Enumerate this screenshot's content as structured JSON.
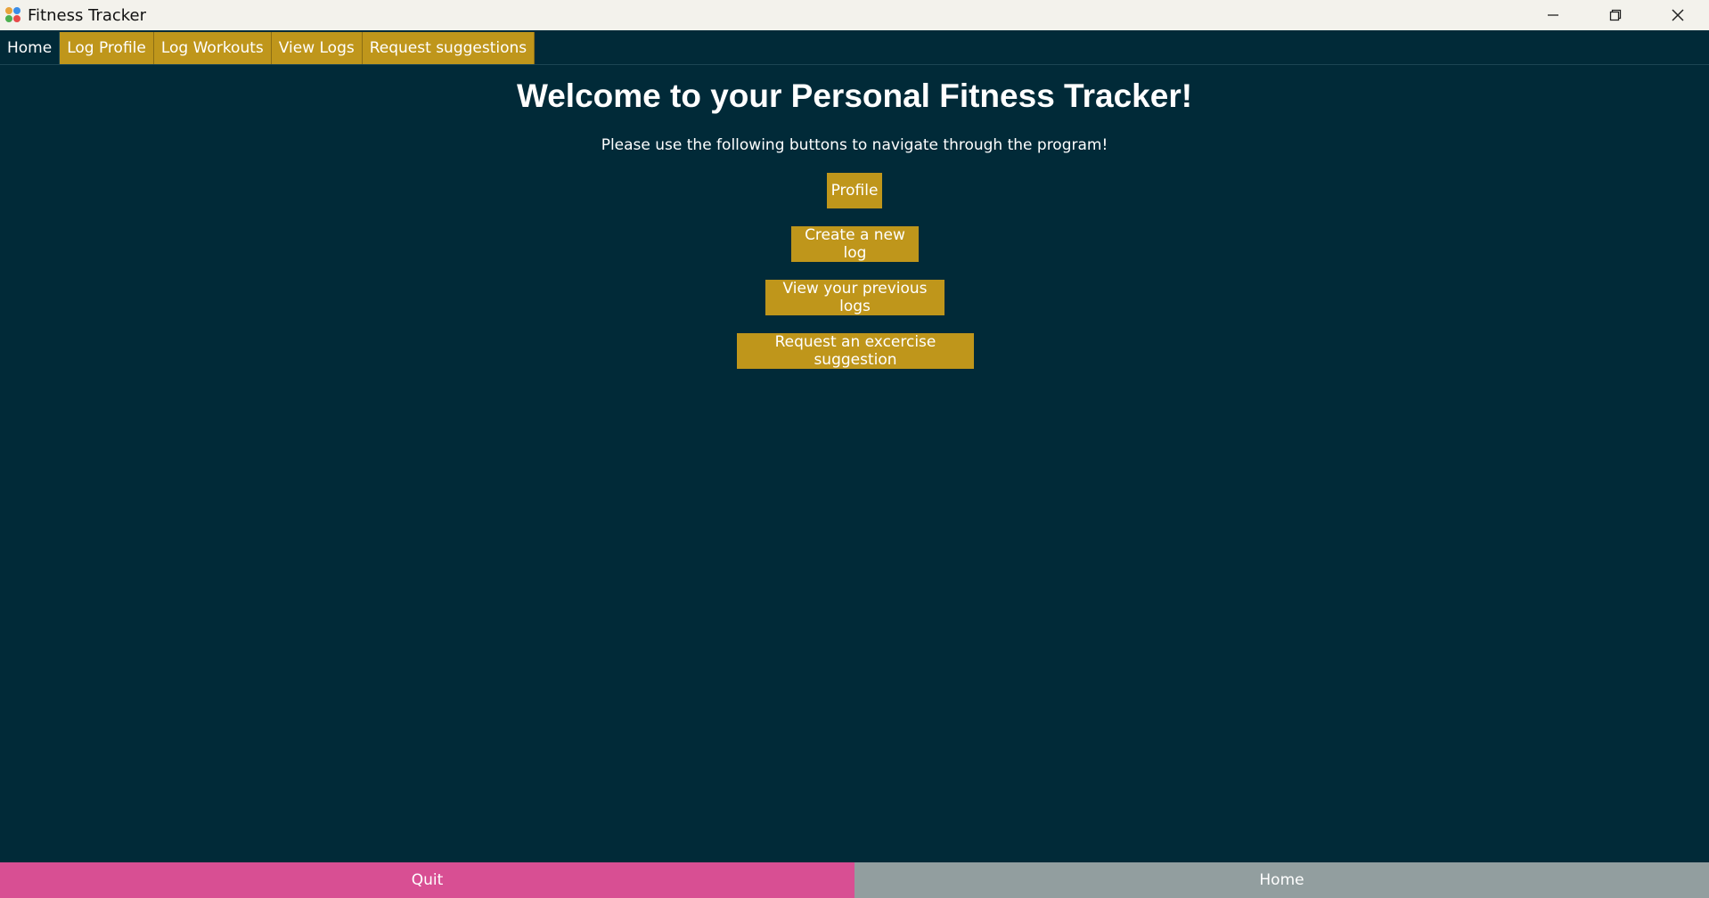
{
  "window": {
    "title": "Fitness Tracker",
    "icon": "app-dots-icon",
    "controls": [
      "minimize-icon",
      "restore-icon",
      "close-icon"
    ]
  },
  "tabs": [
    {
      "label": "Home",
      "active": true
    },
    {
      "label": "Log Profile",
      "active": false
    },
    {
      "label": "Log Workouts",
      "active": false
    },
    {
      "label": "View Logs",
      "active": false
    },
    {
      "label": "Request suggestions",
      "active": false
    }
  ],
  "main": {
    "heading": "Welcome to your Personal Fitness Tracker!",
    "subtitle": "Please use the following buttons to navigate through the program!",
    "buttons": {
      "profile": "Profile",
      "new_log": "Create a new log",
      "previous_logs": "View your previous logs",
      "suggestion": "Request an excercise suggestion"
    }
  },
  "footer": {
    "quit": "Quit",
    "home": "Home"
  },
  "colors": {
    "background": "#012a38",
    "accent": "#bf961b",
    "quit": "#d84f93",
    "home": "#929e9f"
  }
}
